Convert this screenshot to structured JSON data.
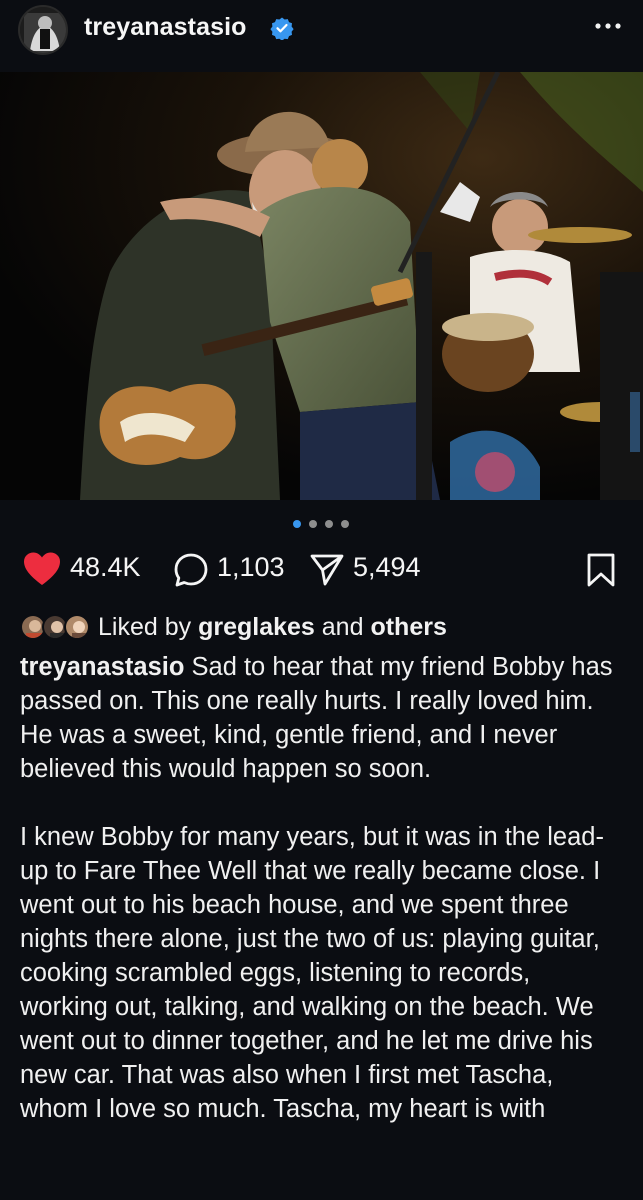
{
  "header": {
    "username": "treyanastasio",
    "verified_icon": "verified-badge-icon",
    "more_icon": "more-horizontal-icon"
  },
  "carousel": {
    "dot_count": 4,
    "active_index": 0,
    "active_color": "#3897f0",
    "inactive_color": "#8e8e8e"
  },
  "actions": {
    "likes": "48.4K",
    "comments": "1,103",
    "shares": "5,494",
    "heart_color": "#ed2d3f"
  },
  "liked_by": {
    "prefix": "Liked by",
    "user": "greglakes",
    "and": "and",
    "others": "others"
  },
  "caption": {
    "user": "treyanastasio",
    "para1": "Sad to hear that my friend Bobby has passed on. This one really hurts. I really loved him. He was a sweet, kind, gentle friend, and I never believed this would happen so soon.",
    "para2": "I knew Bobby for many years, but it was in the lead-up to Fare Thee Well that we really became close. I went out to his beach house, and we spent three nights there alone, just the two of us: playing guitar, cooking scrambled eggs, listening to records, working out, talking, and walking on the beach.  We went out to dinner together, and he let me drive his new car. That was also when I first met Tascha, whom I love so much. Tascha, my heart is with"
  }
}
